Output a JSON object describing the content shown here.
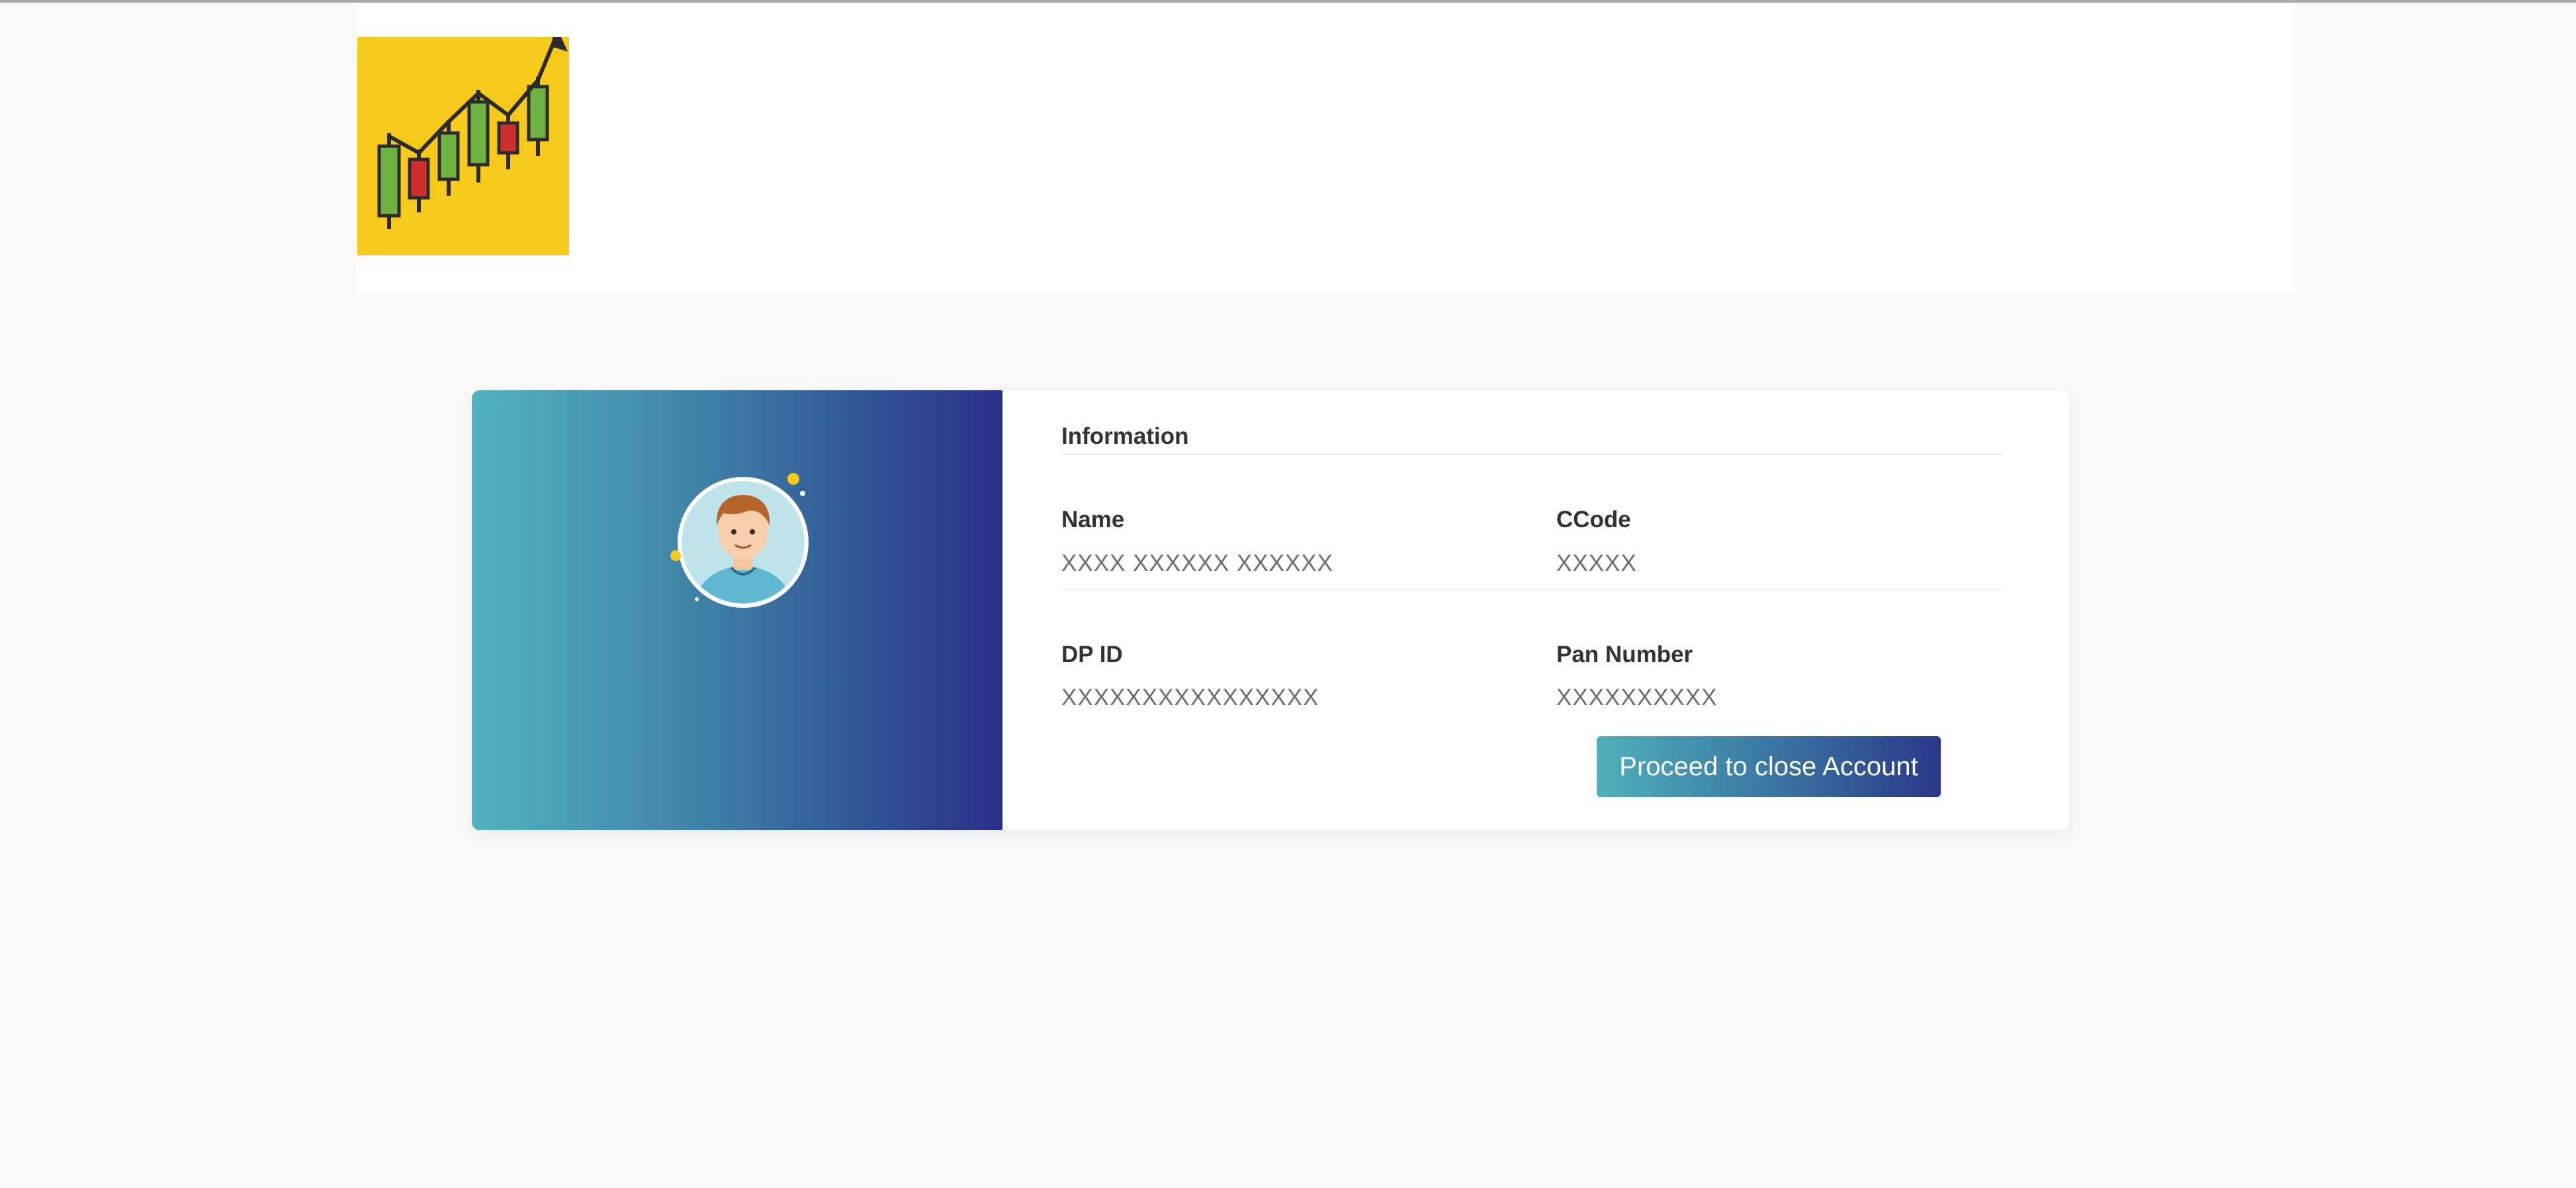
{
  "colors": {
    "logo_bg": "#f6c91b",
    "candle_green": "#6fb343",
    "candle_red": "#d0302d",
    "panel_gradient_start": "#52b3bd",
    "panel_gradient_end": "#2b2f88",
    "button_gradient_start": "#4fb1b9",
    "button_gradient_end": "#2b3788"
  },
  "icons": {
    "logo": "candlestick-chart-trend-up-icon",
    "avatar": "user-avatar-icon"
  },
  "info": {
    "title": "Information",
    "name_label": "Name",
    "name_value": "XXXX XXXXXX XXXXXX",
    "ccode_label": "CCode",
    "ccode_value": "XXXXX",
    "dpid_label": "DP ID",
    "dpid_value": "XXXXXXXXXXXXXXXX",
    "pan_label": "Pan Number",
    "pan_value": "XXXXXXXXXX"
  },
  "actions": {
    "proceed_label": "Proceed to close Account"
  }
}
